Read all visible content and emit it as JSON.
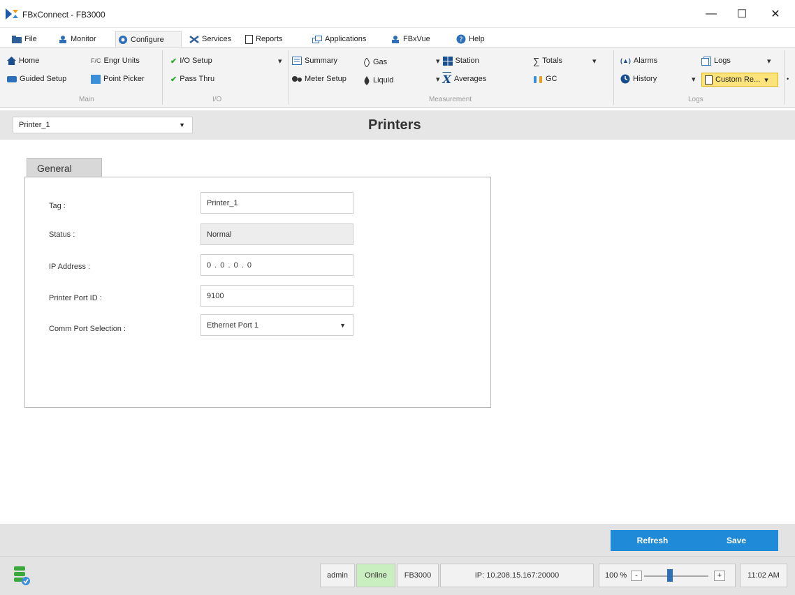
{
  "window": {
    "title": "FBxConnect - FB3000",
    "minimize_glyph": "—",
    "maximize_glyph": "☐",
    "close_glyph": "✕"
  },
  "menu": {
    "tabs": [
      {
        "label": "File",
        "icon": "folder-icon"
      },
      {
        "label": "Monitor",
        "icon": "monitor-icon"
      },
      {
        "label": "Configure",
        "icon": "gear-icon"
      },
      {
        "label": "Services",
        "icon": "tools-icon"
      },
      {
        "label": "Reports",
        "icon": "document-icon"
      },
      {
        "label": "Applications",
        "icon": "windows-icon"
      },
      {
        "label": "FBxVue",
        "icon": "user-icon"
      },
      {
        "label": "Help",
        "icon": "help-icon"
      }
    ],
    "active": "Configure"
  },
  "ribbon": {
    "main": {
      "home": "Home",
      "engr_units": "Engr Units",
      "engr_prefix": "F/C",
      "guided_setup": "Guided Setup",
      "point_picker": "Point Picker",
      "group": "Main"
    },
    "io": {
      "io_setup": "I/O Setup",
      "pass_thru": "Pass Thru",
      "group": "I/O"
    },
    "measurement": {
      "summary": "Summary",
      "meter_setup": "Meter Setup",
      "gas": "Gas",
      "liquid": "Liquid",
      "station": "Station",
      "averages": "Averages",
      "totals": "Totals",
      "gc": "GC",
      "group": "Measurement"
    },
    "logs": {
      "alarms": "Alarms",
      "history": "History",
      "logs": "Logs",
      "custom_reports": "Custom Re...",
      "group": "Logs"
    },
    "dropdown_glyph": "▾"
  },
  "selector": {
    "value": "Printer_1",
    "arrow": "▼"
  },
  "page": {
    "title": "Printers"
  },
  "tabs": {
    "general": "General"
  },
  "form": {
    "tag_label": "Tag :",
    "tag_value": "Printer_1",
    "status_label": "Status :",
    "status_value": "Normal",
    "ip_label": "IP Address :",
    "ip_value": "0 . 0 . 0 . 0",
    "port_label": "Printer Port ID :",
    "port_value": "9100",
    "comm_label": "Comm Port Selection :",
    "comm_value": "Ethernet Port 1",
    "comm_arrow": "▼"
  },
  "actions": {
    "refresh": "Refresh",
    "save": "Save"
  },
  "status": {
    "user": "admin",
    "connection": "Online",
    "device": "FB3000",
    "ip": "IP: 10.208.15.167:20000",
    "zoom": "100 %",
    "zoom_minus": "-",
    "zoom_plus": "+",
    "zoom_level_percent": 40,
    "time": "11:02 AM"
  },
  "colors": {
    "accent": "#1e8ad8",
    "online": "#c9efc0",
    "highlight": "#fde47a"
  }
}
